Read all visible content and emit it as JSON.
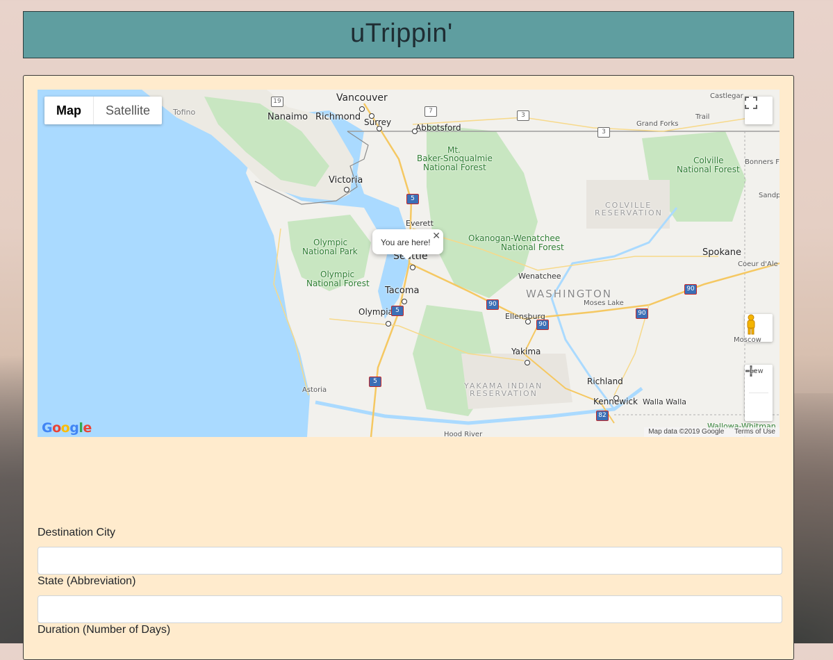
{
  "header": {
    "title": "uTrippin'"
  },
  "map": {
    "type_controls": {
      "map": "Map",
      "satellite": "Satellite",
      "selected": "Map"
    },
    "info_window": {
      "text": "You are here!"
    },
    "attribution": {
      "data": "Map data ©2019 Google",
      "terms": "Terms of Use"
    },
    "logo": "Google",
    "labels": {
      "vancouver": "Vancouver",
      "nanaimo": "Nanaimo",
      "richmond": "Richmond",
      "surrey": "Surrey",
      "abbotsford": "Abbotsford",
      "tofino": "Tofino",
      "victoria": "Victoria",
      "castlegar": "Castlegar",
      "grand_forks": "Grand Forks",
      "trail": "Trail",
      "bonners": "Bonners Fe",
      "sandp": "Sandp",
      "mt": "Mt.",
      "baker": "Baker-Snoqualmie",
      "baker_nf": "National Forest",
      "colville": "Colville",
      "colville_nf": "National Forest",
      "colville_res1": "COLVILLE",
      "colville_res2": "RESERVATION",
      "everett": "Everett",
      "olympic_np1": "Olympic",
      "olympic_np2": "National Park",
      "olympic_nf1": "Olympic",
      "olympic_nf2": "National Forest",
      "okanogan1": "Okanogan-Wenatchee",
      "okanogan2": "National Forest",
      "seattle": "Seattle",
      "spokane": "Spokane",
      "coeur": "Coeur d'Ale",
      "wenatchee": "Wenatchee",
      "washington": "WASHINGTON",
      "moses": "Moses Lake",
      "tacoma": "Tacoma",
      "olympia": "Olympia",
      "ellensburg": "Ellensburg",
      "yakima": "Yakima",
      "moscow": "Moscow",
      "lew": "Lew",
      "yakama1": "YAKAMA INDIAN",
      "yakama2": "RESERVATION",
      "richland": "Richland",
      "kennewick": "Kennewick",
      "walla": "Walla Walla",
      "astoria": "Astoria",
      "wallowa": "Wallowa-Whitman",
      "hood": "Hood River"
    },
    "shields": {
      "s19": "19",
      "s7": "7",
      "s3a": "3",
      "s3b": "3",
      "i5a": "5",
      "i5b": "5",
      "i5c": "5",
      "i90a": "90",
      "i90b": "90",
      "i90c": "90",
      "i90d": "90",
      "i82": "82"
    }
  },
  "form": {
    "destination_label": "Destination City",
    "state_label": "State (Abbreviation)",
    "duration_label": "Duration (Number of Days)",
    "destination_value": "",
    "state_value": ""
  },
  "colors": {
    "header_bg": "#5f9ea0",
    "card_bg": "#ffebcd",
    "water": "#aadaff",
    "land": "#f2f1ed",
    "forest": "#c8e6c1"
  }
}
